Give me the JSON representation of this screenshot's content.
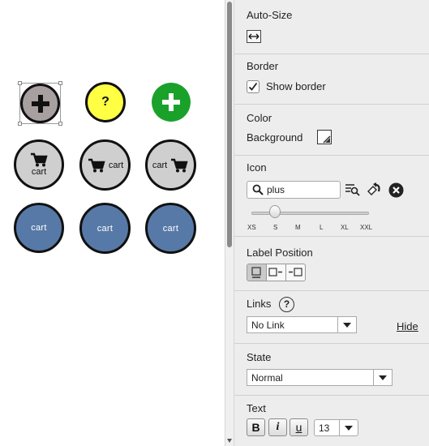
{
  "canvas": {
    "buttons": [
      {
        "name": "plus-button-selected",
        "label": ""
      },
      {
        "name": "help-button",
        "label": "?"
      },
      {
        "name": "add-button-green",
        "label": ""
      },
      {
        "name": "cart-button-icon-top",
        "label": "cart"
      },
      {
        "name": "cart-button-icon-left",
        "label": "cart"
      },
      {
        "name": "cart-button-icon-right",
        "label": "cart"
      },
      {
        "name": "cart-button-blue-1",
        "label": "cart"
      },
      {
        "name": "cart-button-blue-2",
        "label": "cart"
      },
      {
        "name": "cart-button-blue-3",
        "label": "cart"
      }
    ]
  },
  "inspector": {
    "autosize": {
      "title": "Auto-Size"
    },
    "border": {
      "title": "Border",
      "show_border_label": "Show border",
      "show_border_checked": true
    },
    "color": {
      "title": "Color",
      "background_label": "Background"
    },
    "icon": {
      "title": "Icon",
      "search_value": "plus",
      "size_ticks": [
        "XS",
        "S",
        "M",
        "L",
        "XL",
        "XXL"
      ],
      "selected_size": "S"
    },
    "label_position": {
      "title": "Label Position"
    },
    "links": {
      "title": "Links",
      "help": "?",
      "value": "No Link",
      "hide_link": "Hide"
    },
    "state": {
      "title": "State",
      "value": "Normal"
    },
    "text": {
      "title": "Text",
      "bold": "B",
      "italic": "i",
      "underline": "u",
      "font_size": "13"
    }
  },
  "colors": {
    "selected_fill": "#a8a0a0",
    "help_fill": "#ffff44",
    "green_fill": "#1aa12a",
    "cart_grey": "#cfcfcf",
    "cart_blue": "#5779a7"
  }
}
